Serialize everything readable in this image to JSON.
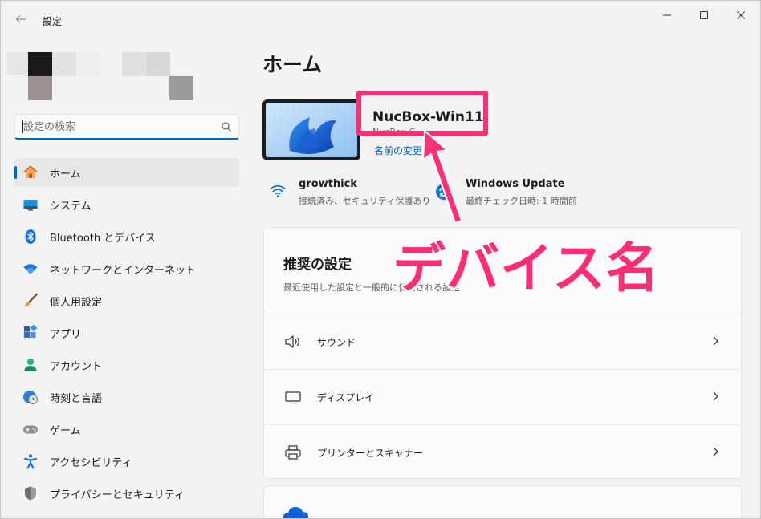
{
  "window": {
    "title": "設定"
  },
  "search": {
    "placeholder": "設定の検索"
  },
  "sidebar": {
    "items": [
      {
        "label": "ホーム",
        "icon": "home-icon",
        "active": true
      },
      {
        "label": "システム",
        "icon": "system-icon"
      },
      {
        "label": "Bluetooth とデバイス",
        "icon": "bluetooth-icon"
      },
      {
        "label": "ネットワークとインターネット",
        "icon": "network-icon"
      },
      {
        "label": "個人用設定",
        "icon": "brush-icon"
      },
      {
        "label": "アプリ",
        "icon": "apps-icon"
      },
      {
        "label": "アカウント",
        "icon": "account-icon"
      },
      {
        "label": "時刻と言語",
        "icon": "time-language-icon"
      },
      {
        "label": "ゲーム",
        "icon": "gaming-icon"
      },
      {
        "label": "アクセシビリティ",
        "icon": "accessibility-icon"
      },
      {
        "label": "プライバシーとセキュリティ",
        "icon": "shield-icon"
      }
    ]
  },
  "main": {
    "title": "ホーム",
    "device": {
      "name": "NucBox-Win11",
      "model": "NucBox G",
      "rename": "名前の変更"
    },
    "status": {
      "wifi": {
        "title": "growthick",
        "sub": "接続済み、セキュリティ保護あり"
      },
      "update": {
        "title": "Windows Update",
        "sub": "最終チェック日時: 1 時間前"
      }
    },
    "recommended": {
      "title": "推奨の設定",
      "subtitle": "最近使用した設定と一般的に使用される設定",
      "items": [
        {
          "label": "サウンド",
          "icon": "speaker-icon"
        },
        {
          "label": "ディスプレイ",
          "icon": "monitor-icon"
        },
        {
          "label": "プリンターとスキャナー",
          "icon": "printer-icon"
        }
      ]
    }
  },
  "annotation": {
    "text": "デバイス名",
    "color": "#ff2d77"
  },
  "colors": {
    "accent": "#0067c0",
    "link": "#005fb8",
    "annotation": "#ff2d77"
  }
}
